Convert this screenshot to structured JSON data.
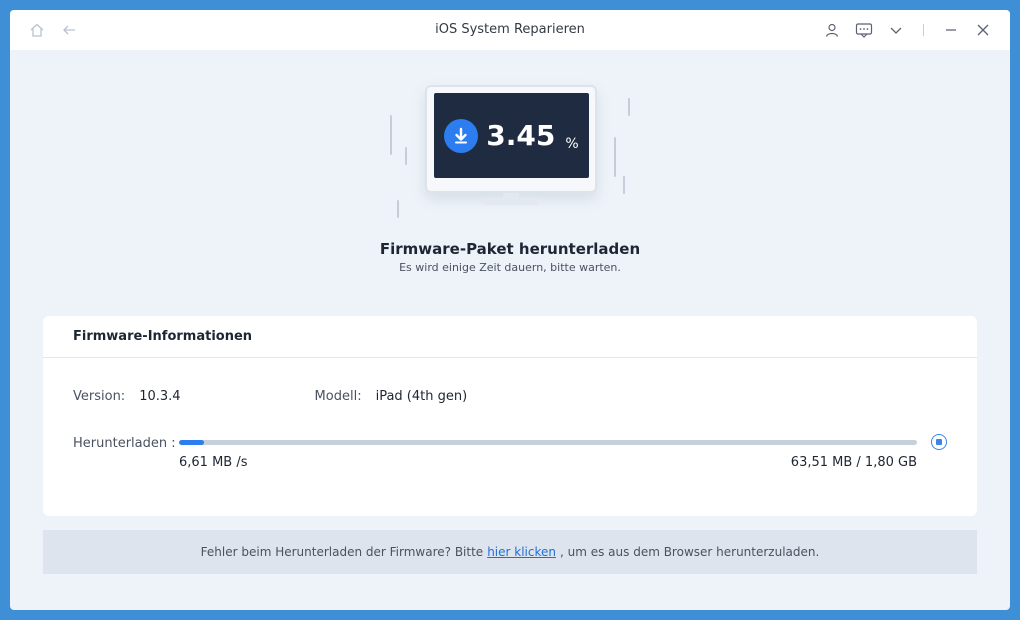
{
  "window": {
    "title": "iOS System Reparieren"
  },
  "titlebar": {
    "left_icons": [
      "home-icon",
      "back-arrow-icon"
    ],
    "right_icons": [
      "user-icon",
      "feedback-icon",
      "menu-chevron-icon",
      "minimize-icon",
      "close-icon"
    ]
  },
  "hero": {
    "percent_value": "3.45",
    "percent_sign": "%",
    "title": "Firmware-Paket herunterladen",
    "subtitle": "Es wird einige Zeit dauern, bitte warten."
  },
  "card": {
    "header": "Firmware-Informationen",
    "version_label": "Version:",
    "version_value": "10.3.4",
    "model_label": "Modell:",
    "model_value": "iPad (4th gen)",
    "download_label": "Herunterladen :",
    "progress_fraction": 0.0345,
    "speed": "6,61 MB /s",
    "size": "63,51 MB / 1,80 GB"
  },
  "footer": {
    "text_before": "Fehler beim Herunterladen der Firmware? Bitte",
    "link_text": "hier klicken",
    "text_after": ", um es aus dem Browser herunterzuladen."
  },
  "colors": {
    "accent": "#2b7df0",
    "screen": "#1e2b40",
    "window_bg": "#eef3f9",
    "frame": "#3f8fd6"
  }
}
